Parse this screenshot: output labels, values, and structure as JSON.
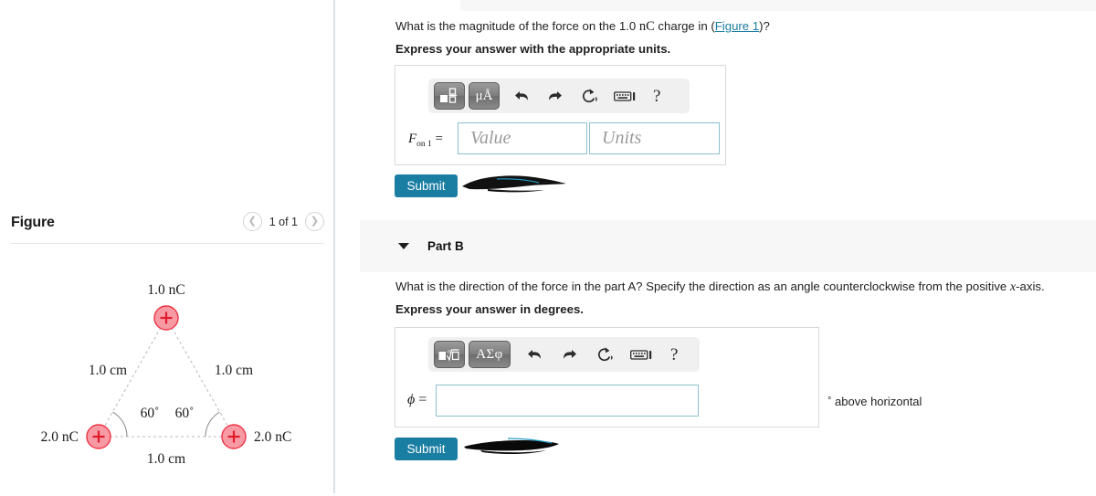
{
  "figure_panel": {
    "title": "Figure",
    "prev_icon": "chevron-left-icon",
    "next_icon": "chevron-right-icon",
    "counter": "1 of 1",
    "diagram": {
      "charges": [
        {
          "id": "top",
          "label": "1.0 nC",
          "sign": "+",
          "fill": "#f79aa4",
          "stroke": "#ee3344"
        },
        {
          "id": "bottom-left",
          "label": "2.0 nC",
          "sign": "+",
          "fill": "#f79aa4",
          "stroke": "#ee3344"
        },
        {
          "id": "bottom-right",
          "label": "2.0 nC",
          "sign": "+",
          "fill": "#f79aa4",
          "stroke": "#ee3344"
        }
      ],
      "side_labels": {
        "left": "1.0 cm",
        "right": "1.0 cm",
        "bottom": "1.0 cm"
      },
      "angle_labels": {
        "left": "60˚",
        "right": "60˚"
      }
    }
  },
  "part_a": {
    "question_prefix": "What is the magnitude of the force on the 1.0 ",
    "question_unit": "nC",
    "question_mid": " charge in (",
    "figure_link": "Figure 1",
    "question_suffix": ")?",
    "instruction": "Express your answer with the appropriate units.",
    "toolbar": {
      "template_icon": "math-template-icon",
      "units_icon": "micro-angstrom-units-icon",
      "units_label": "μÅ",
      "undo_icon": "undo-arrow-icon",
      "redo_icon": "redo-arrow-icon",
      "reset_icon": "reset-circular-arrow-icon",
      "keyboard_icon": "keyboard-icon",
      "help_icon": "help-question-icon",
      "help_label": "?"
    },
    "answer_label_main": "F",
    "answer_label_sub": "on 1",
    "answer_label_eq": "=",
    "value_placeholder": "Value",
    "value": "",
    "units_placeholder": "Units",
    "units": "",
    "submit_label": "Submit",
    "redacted_text": "redacted-scribble"
  },
  "part_b": {
    "caret_icon": "caret-down-icon",
    "header": "Part B",
    "question_prefix": "What is the direction of the force in the part A? Specify the direction as an angle counterclockwise from the positive ",
    "question_var": "x",
    "question_suffix": "-axis.",
    "instruction": "Express your answer in degrees.",
    "toolbar": {
      "template_icon": "nth-root-template-icon",
      "greek_icon": "greek-letters-icon",
      "greek_label": "ΑΣφ",
      "undo_icon": "undo-arrow-icon",
      "redo_icon": "redo-arrow-icon",
      "reset_icon": "reset-circular-arrow-icon",
      "keyboard_icon": "keyboard-icon",
      "help_icon": "help-question-icon",
      "help_label": "?"
    },
    "answer_label": "ϕ",
    "answer_label_eq": "=",
    "value": "",
    "suffix_degree": "°",
    "suffix_text": "above horizontal",
    "submit_label": "Submit",
    "redacted_text": "redacted-scribble"
  },
  "colors": {
    "accent": "#1a7ea3",
    "link": "#1a7ea3",
    "field_border": "#8cbfd0",
    "band": "#f7f7f7",
    "charge_fill": "#f79aa4",
    "charge_stroke": "#ee3344"
  }
}
